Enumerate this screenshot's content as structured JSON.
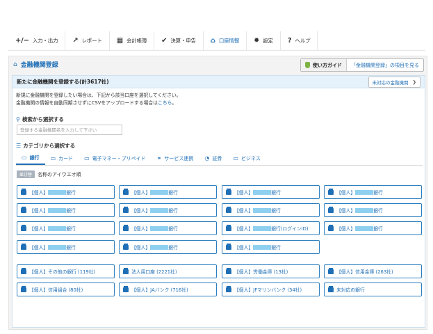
{
  "nav": {
    "items": [
      {
        "icon": "+/−",
        "label": "入力・出力",
        "active": false,
        "name": "nav-input-output"
      },
      {
        "icon": "↗",
        "label": "レポート",
        "active": false,
        "name": "nav-report"
      },
      {
        "icon": "▦",
        "label": "会計帳簿",
        "active": false,
        "name": "nav-ledger"
      },
      {
        "icon": "✔",
        "label": "決算・申告",
        "active": false,
        "name": "nav-settlement"
      },
      {
        "icon": "⌂",
        "label": "口座情報",
        "active": true,
        "name": "nav-account-info"
      },
      {
        "icon": "✹",
        "label": "設定",
        "active": false,
        "name": "nav-settings"
      },
      {
        "icon": "?",
        "label": "ヘルプ",
        "active": false,
        "name": "nav-help"
      }
    ]
  },
  "page": {
    "title": "金融機関登録",
    "guide_label": "使い方ガイド",
    "guide_link": "「金融機関登録」の項目を見る"
  },
  "panel": {
    "heading": "新たに金融機関を登録する(計3617社)",
    "unsupported_button": "未対応の金融機関",
    "desc_line1": "新規に金融機関を登録したい場合は、下記から該当口座を選択してください。",
    "desc_line2": "金融機関の情報を自動同期させずにCSVをアップロードする場合は",
    "desc_link": "こちら",
    "desc_tail": "。"
  },
  "search": {
    "heading": "検索から選択する",
    "placeholder": "登録する金融機関名を入力して下さい"
  },
  "category": {
    "heading": "カテゴリから選択する",
    "tabs": [
      {
        "icon": "▭",
        "label": "銀行",
        "active": true
      },
      {
        "icon": "▭",
        "label": "カード",
        "active": false
      },
      {
        "icon": "▭",
        "label": "電子マネー・プリペイド",
        "active": false
      },
      {
        "icon": "⚭",
        "label": "サービス連携",
        "active": false
      },
      {
        "icon": "◔",
        "label": "証券",
        "active": false
      },
      {
        "icon": "▭",
        "label": "ビジネス",
        "active": false
      }
    ]
  },
  "sort": {
    "badge": "並び替",
    "label": "名称のアイウエオ順"
  },
  "banks": [
    {
      "prefix": "【個人】",
      "suffix": "銀行",
      "masked": true
    },
    {
      "prefix": "【個人】",
      "suffix": "銀行",
      "masked": true
    },
    {
      "prefix": "【個人】",
      "suffix": "銀行",
      "masked": true
    },
    {
      "prefix": "【個人】",
      "suffix": "銀行",
      "masked": true
    },
    {
      "prefix": "【個人】",
      "suffix": "銀行",
      "masked": true
    },
    {
      "prefix": "【個人】",
      "suffix": "銀行",
      "masked": true
    },
    {
      "prefix": "【個人】",
      "suffix": "銀行",
      "masked": true
    },
    {
      "prefix": "【個人】",
      "suffix": "銀行",
      "masked": true
    },
    {
      "prefix": "【個人】",
      "suffix": "銀行",
      "masked": true
    },
    {
      "prefix": "【個人】",
      "suffix": "銀行",
      "masked": true
    },
    {
      "prefix": "【個人】",
      "suffix": "銀行(ログインID)",
      "masked": true
    },
    {
      "prefix": "【個人】",
      "suffix": "銀行",
      "masked": true
    },
    {
      "prefix": "【個人】",
      "suffix": "銀行",
      "masked": true
    },
    {
      "prefix": "【個人】",
      "suffix": "銀行",
      "masked": true
    },
    {
      "prefix": "【個人】",
      "suffix": "銀行",
      "masked": true
    }
  ],
  "groups": [
    {
      "label": "【個人】その他の銀行 (119社)"
    },
    {
      "label": "法人用口座 (2221社)"
    },
    {
      "label": "【個人】労働金庫 (13社)"
    },
    {
      "label": "【個人】信用金庫 (263社)"
    },
    {
      "label": "【個人】信用組合 (80社)"
    },
    {
      "label": "【個人】JAバンク (716社)"
    },
    {
      "label": "【個人】JFマリンバンク (34社)"
    },
    {
      "label": "未対応の銀行"
    }
  ]
}
